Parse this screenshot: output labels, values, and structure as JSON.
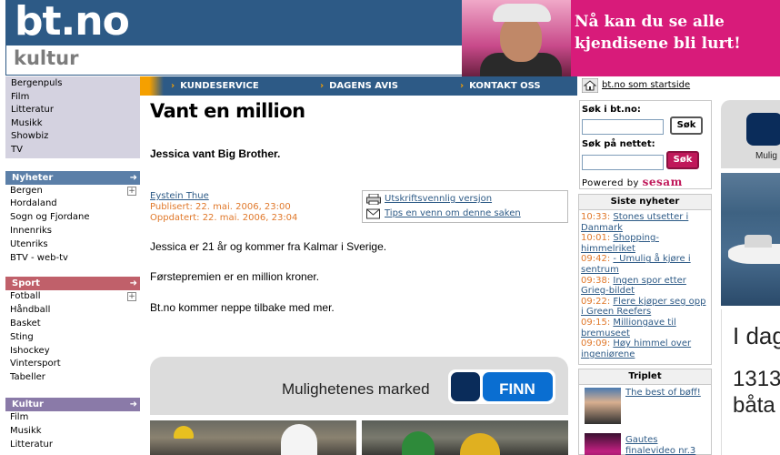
{
  "header": {
    "logo": "bt.no",
    "section": "kultur",
    "ad_text": "Nå kan du se alle kjendisene bli lurt!"
  },
  "topnav": {
    "items": [
      "KUNDESERVICE",
      "DAGENS AVIS",
      "KONTAKT OSS"
    ],
    "startpage": "bt.no som startside"
  },
  "leftnav": {
    "top_items": [
      "Bergenpuls",
      "Film",
      "Litteratur",
      "Musikk",
      "Showbiz",
      "TV"
    ],
    "sections": [
      {
        "title": "Nyheter",
        "items": [
          "Bergen",
          "Hordaland",
          "Sogn og Fjordane",
          "Innenriks",
          "Utenriks",
          "BTV - web-tv"
        ]
      },
      {
        "title": "Sport",
        "items": [
          "Fotball",
          "Håndball",
          "Basket",
          "Sting",
          "Ishockey",
          "Vintersport",
          "Tabeller"
        ]
      },
      {
        "title": "Kultur",
        "items": [
          "Film",
          "Musikk",
          "Litteratur"
        ]
      }
    ]
  },
  "article": {
    "title": "Vant en million",
    "lead": "Jessica vant Big Brother.",
    "author": "Eystein Thue",
    "published": "Publisert: 22. mai. 2006, 23:00",
    "updated": "Oppdatert: 22. mai. 2006, 23:04",
    "tool_print": "Utskriftsvennlig versjon",
    "tool_tip": "Tips en venn om denne saken",
    "paragraphs": [
      "Jessica er 21 år og kommer fra Kalmar i Sverige.",
      "Førstepremien er en million kroner.",
      "Bt.no kommer neppe tilbake med mer."
    ]
  },
  "finn": {
    "text": "Mulighetenes marked",
    "logo": "FINN"
  },
  "search": {
    "label_site": "Søk i bt.no:",
    "label_web": "Søk på nettet:",
    "button": "Søk",
    "powered": "Powered by",
    "sesam": "sesam"
  },
  "latest": {
    "title": "Siste nyheter",
    "items": [
      {
        "time": "10:33:",
        "text": "Stones utsetter i Danmark"
      },
      {
        "time": "10:01:",
        "text": "Shopping-himmelriket"
      },
      {
        "time": "09:42:",
        "text": "- Umulig å kjøre i sentrum"
      },
      {
        "time": "09:38:",
        "text": "Ingen spor etter Grieg-bildet"
      },
      {
        "time": "09:22:",
        "text": "Flere kjøper seg opp i Green Reefers"
      },
      {
        "time": "09:15:",
        "text": "Milliongave til bremuseet"
      },
      {
        "time": "09:09:",
        "text": "Høy himmel over ingeniørene"
      }
    ]
  },
  "triplet": {
    "title": "Triplet",
    "items": [
      {
        "text": "The best of bøff!"
      },
      {
        "text": "Gautes finalevideo nr.3"
      }
    ]
  },
  "ad_right": {
    "finn_text": "Mulig",
    "text1": "I dag",
    "text2": "1313",
    "text3": "båta"
  },
  "colors": {
    "brand_blue": "#2d5a86",
    "accent_orange": "#e0782a",
    "nav_group_bg": "#d4d2e0",
    "nyheter_head": "#5b7fa8",
    "sport_head": "#c0606a",
    "kultur_head": "#8a7aa8",
    "ad_pink": "#d81b7a"
  }
}
